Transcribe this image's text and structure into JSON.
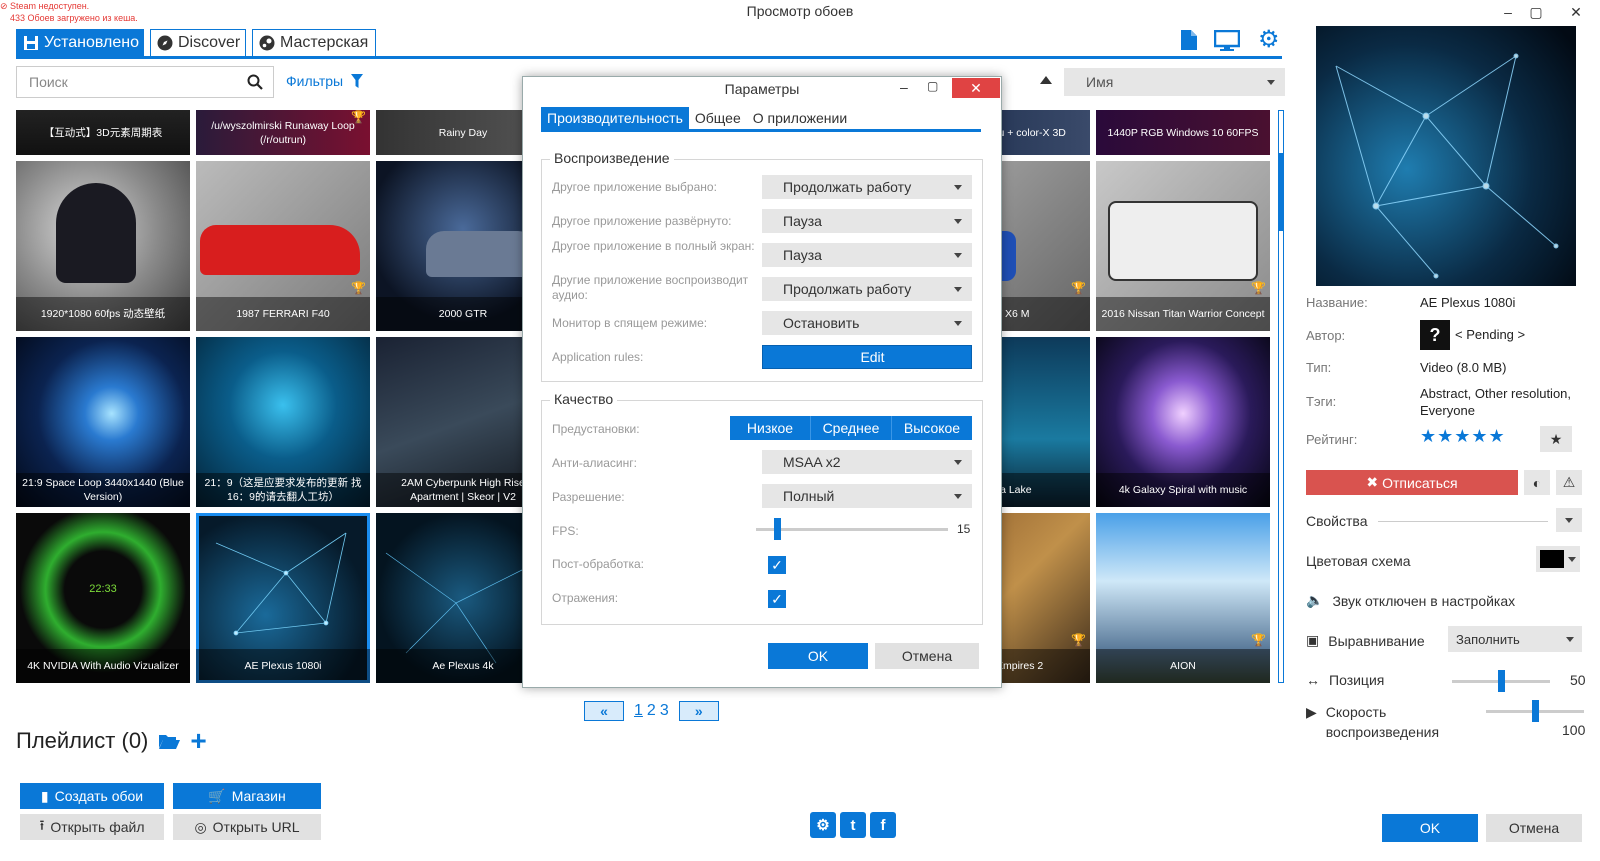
{
  "status": {
    "line1": "Steam недоступен.",
    "line2": "433 Обоев загружено из кеша."
  },
  "window": {
    "title": "Просмотр обоев"
  },
  "tabs": [
    {
      "label": "Установлено",
      "icon": "save-icon"
    },
    {
      "label": "Discover",
      "icon": "compass-icon"
    },
    {
      "label": "Мастерская",
      "icon": "steam-icon"
    }
  ],
  "search": {
    "placeholder": "Поиск"
  },
  "filters_label": "Фильтры",
  "sort": {
    "value": "Имя"
  },
  "tiles": [
    {
      "label": "【互动式】3D元素周期表"
    },
    {
      "label": "/u/wyszolmirski Runaway Loop (/r/outrun)"
    },
    {
      "label": "Rainy Day"
    },
    {
      "label": "Hatsune miku + color-X 3D"
    },
    {
      "label": "1440P RGB Windows 10 60FPS"
    },
    {
      "label": "1920*1080 60fps 动态壁纸"
    },
    {
      "label": "1987 FERRARI F40"
    },
    {
      "label": "2000 GTR"
    },
    {
      "label": "BMW X6 M"
    },
    {
      "label": "2016 Nissan Titan Warrior Concept"
    },
    {
      "label": "21:9 Space Loop 3440x1440 (Blue Version)"
    },
    {
      "label": "21：9（这是应要求发布的更新 找16：9的请去翻人工坊）"
    },
    {
      "label": "2AM Cyberpunk High Rise Apartment | Skeor | V2"
    },
    {
      "label": "Aurora Lake"
    },
    {
      "label": "4k Galaxy Spiral with music"
    },
    {
      "label": "4K NVIDIA With Audio Vizualizer"
    },
    {
      "label": "AE Plexus 1080i"
    },
    {
      "label": "Ae Plexus 4k"
    },
    {
      "label": "Age of Empires 2"
    },
    {
      "label": "AION"
    }
  ],
  "clock": "22:33",
  "pager": {
    "prev": "«",
    "next": "»",
    "pages": [
      "1",
      "2",
      "3"
    ]
  },
  "playlist": {
    "title": "Плейлист (0)"
  },
  "bottom_buttons": {
    "create": "Создать обои",
    "shop": "Магазин",
    "open_file": "Открыть файл",
    "open_url": "Открыть URL"
  },
  "details": {
    "name_label": "Название:",
    "name": "AE Plexus 1080i",
    "author_label": "Автор:",
    "author": "< Pending >",
    "author_avatar": "?",
    "type_label": "Тип:",
    "type": "Video (8.0 MB)",
    "tags_label": "Тэги:",
    "tags": "Abstract, Other resolution, Everyone",
    "rating_label": "Рейтинг:",
    "rating": 5,
    "stars": "★★★★★"
  },
  "unsubscribe": "Отписаться",
  "props": {
    "properties": "Свойства",
    "color_scheme": "Цветовая схема",
    "sound": "Звук отключен в настройках",
    "alignment": "Выравнивание",
    "alignment_value": "Заполнить",
    "position": "Позиция",
    "position_value": "50",
    "speed": "Скорость воспроизведения",
    "speed_value": "100"
  },
  "main_ok": "OK",
  "main_cancel": "Отмена",
  "dialog": {
    "title": "Параметры",
    "tabs": [
      "Производительность",
      "Общее",
      "О приложении"
    ],
    "playback": {
      "title": "Воспроизведение",
      "rows": [
        {
          "label": "Другое приложение выбрано:",
          "value": "Продолжать работу"
        },
        {
          "label": "Другое приложение развёрнуто:",
          "value": "Пауза"
        },
        {
          "label": "Другое приложение в полный экран:",
          "value": "Пауза"
        },
        {
          "label": "Другие приложение воспроизводит аудио:",
          "value": "Продолжать работу"
        },
        {
          "label": "Монитор в спящем режиме:",
          "value": "Остановить"
        }
      ],
      "rules_label": "Application rules:",
      "rules_button": "Edit"
    },
    "quality": {
      "title": "Качество",
      "presets_label": "Предустановки:",
      "presets": [
        "Низкое",
        "Среднее",
        "Высокое"
      ],
      "aa_label": "Анти-алиасинг:",
      "aa_value": "MSAA x2",
      "res_label": "Разрешение:",
      "res_value": "Полный",
      "fps_label": "FPS:",
      "fps_value": "15",
      "post_label": "Пост-обработка:",
      "refl_label": "Отражения:"
    },
    "ok": "OK",
    "cancel": "Отмена"
  }
}
